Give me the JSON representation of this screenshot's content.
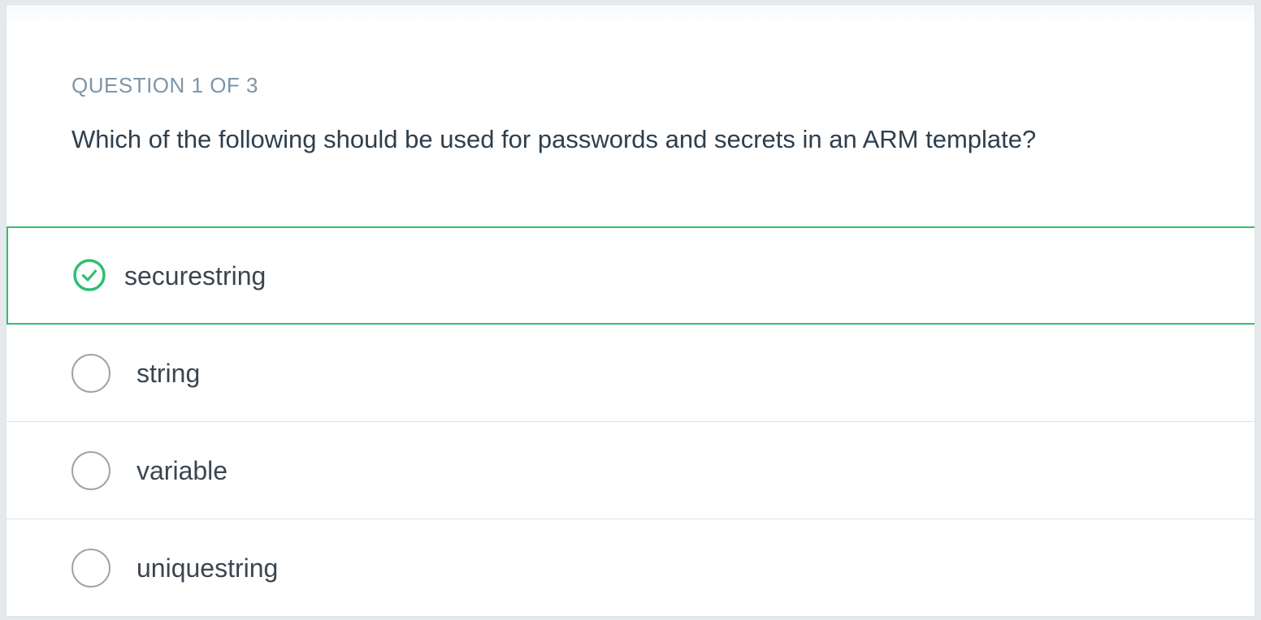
{
  "quiz": {
    "counter": "QUESTION 1 OF 3",
    "question": "Which of the following should be used for passwords and secrets in an ARM template?",
    "options": [
      {
        "label": "securestring",
        "selected": true
      },
      {
        "label": "string",
        "selected": false
      },
      {
        "label": "variable",
        "selected": false
      },
      {
        "label": "uniquestring",
        "selected": false
      }
    ]
  },
  "colors": {
    "accent_green": "#2fbf71",
    "counter_text": "#7d95a8",
    "question_text": "#2e3f4d",
    "radio_border": "#9aa5ae"
  },
  "icons": {
    "selected": "check-circle-icon",
    "unselected": "radio-circle-icon"
  }
}
